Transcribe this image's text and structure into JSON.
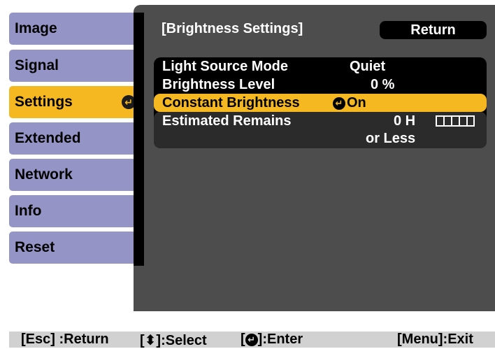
{
  "menu": {
    "tabs": [
      {
        "label": "Image",
        "active": false
      },
      {
        "label": "Signal",
        "active": false
      },
      {
        "label": "Settings",
        "active": true
      },
      {
        "label": "Extended",
        "active": false
      },
      {
        "label": "Network",
        "active": false
      },
      {
        "label": "Info",
        "active": false
      },
      {
        "label": "Reset",
        "active": false
      }
    ]
  },
  "panel": {
    "title": "[Brightness Settings]",
    "return_label": "Return",
    "rows": [
      {
        "label": "Light Source Mode",
        "value": "Quiet"
      },
      {
        "label": "Brightness Level",
        "value": "0 %"
      },
      {
        "label": "Constant Brightness",
        "value": "On",
        "selected": true
      },
      {
        "label": "Estimated Remains",
        "value": "0 H",
        "value2": "or Less"
      }
    ]
  },
  "help": {
    "return": "[Esc] :Return",
    "select": "[⬍]:Select",
    "enter_open": "[",
    "enter_close": "]:Enter",
    "exit": "[Menu]:Exit"
  },
  "colors": {
    "tab": "#9594c6",
    "active_tab": "#f6b820",
    "panel": "#4d4d4d",
    "help_bar": "#d1d1d1"
  },
  "icons": {
    "enter_icon": "circled-return-arrow",
    "select_icon": "up-down-arrows"
  }
}
